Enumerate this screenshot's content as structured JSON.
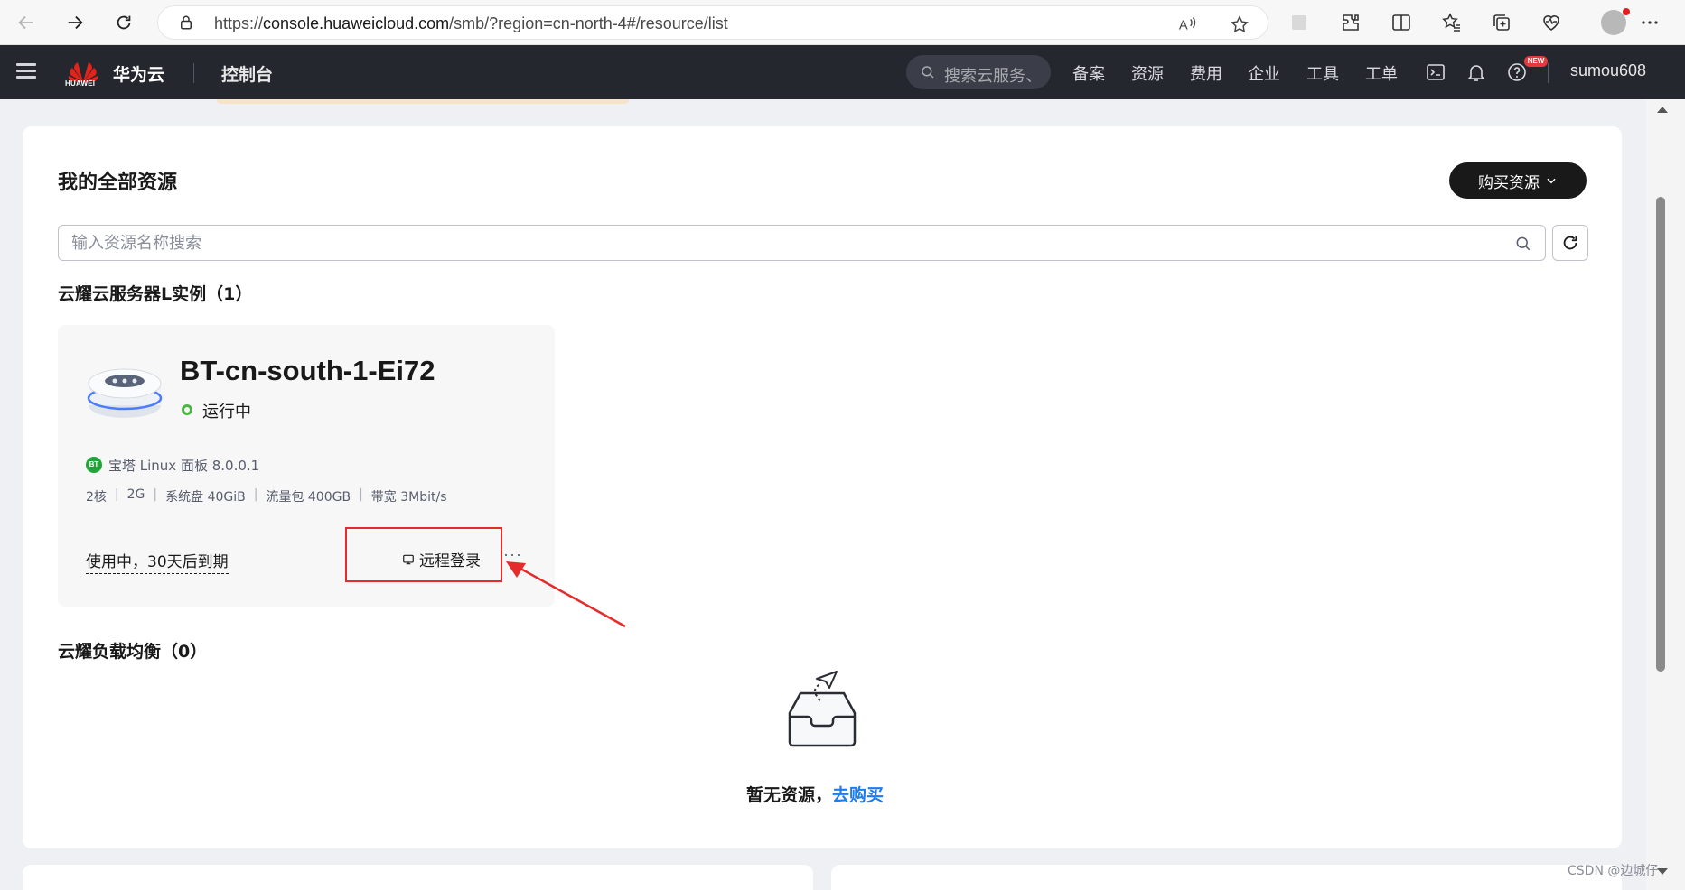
{
  "browser": {
    "url_prefix": "https://",
    "url_host": "console.huaweicloud.com",
    "url_path": "/smb/?region=cn-north-4#/resource/list"
  },
  "header": {
    "logo_text": "HUAWEI",
    "brand": "华为云",
    "console_title": "控制台",
    "search_placeholder": "搜索云服务、",
    "nav": [
      "备案",
      "资源",
      "费用",
      "企业",
      "工具",
      "工单"
    ],
    "new_badge": "NEW",
    "username": "sumou608"
  },
  "main": {
    "title": "我的全部资源",
    "buy_button": "购买资源",
    "search_placeholder": "输入资源名称搜索",
    "sections": {
      "ecs": {
        "title": "云耀云服务器L实例（1）"
      },
      "elb": {
        "title": "云耀负载均衡（0）"
      }
    },
    "instance": {
      "name": "BT-cn-south-1-Ei72",
      "status": "运行中",
      "image_badge": "BT",
      "image": "宝塔 Linux 面板 8.0.0.1",
      "specs": [
        "2核",
        "2G",
        "系统盘 40GiB",
        "流量包 400GB",
        "带宽 3Mbit/s"
      ],
      "expire": "使用中，30天后到期",
      "remote_login": "远程登录",
      "more": "···"
    },
    "empty": {
      "text": "暂无资源，",
      "link": "去购买"
    }
  },
  "watermark": "CSDN @边城仔",
  "colors": {
    "header_bg": "#25272f",
    "accent_link": "#1e7cf1",
    "status_running": "#4bb543",
    "highlight": "#e52b2b",
    "buy_button_bg": "#191919"
  }
}
